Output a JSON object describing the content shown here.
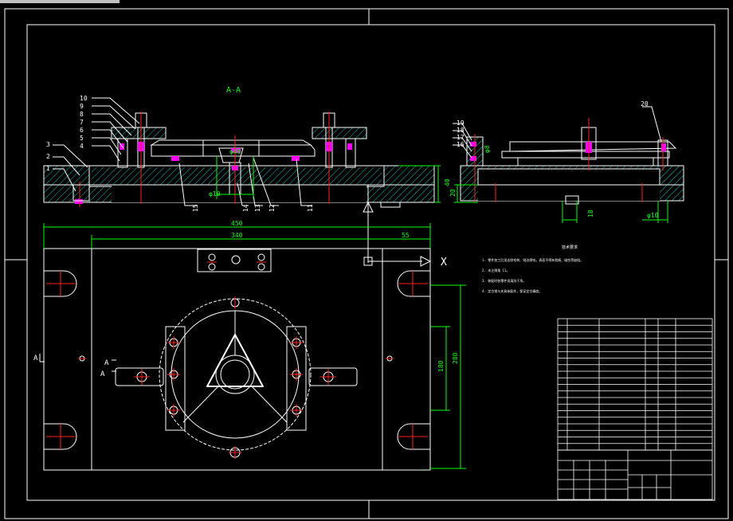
{
  "colors": {
    "background": "#000000",
    "line": "#ffffff",
    "dimension": "#00ff00",
    "centerline": "#ff2020",
    "hatch": "#00c0c0",
    "highlight": "#ff00ff",
    "label": "#ffffff"
  },
  "section_view": {
    "title": "A-A",
    "callouts": [
      "10",
      "9",
      "8",
      "7",
      "6",
      "5",
      "4",
      "3",
      "2",
      "1",
      "15",
      "14",
      "13",
      "12",
      "11"
    ],
    "dims": {
      "height": "40",
      "base": "20",
      "fit1": "φ40",
      "fit2": "φ10"
    }
  },
  "side_view": {
    "callouts": [
      "19",
      "18",
      "17",
      "16",
      "20"
    ],
    "dims": {
      "height": "20",
      "gap": "18",
      "fit": "φ8",
      "pin": "φ10"
    }
  },
  "plan_view": {
    "dims": {
      "overall_width": "450",
      "inner_width": "340",
      "offset": "55",
      "height1": "180",
      "height2": "280"
    },
    "section_marks": [
      "A",
      "A",
      "A"
    ],
    "axis_label": "X"
  },
  "notes": {
    "title": "技术要求",
    "lines": [
      "1. 零件加工后须去除毛刺、锐边倒钝，表面不得有划痕、碰伤等缺陷。",
      "2. 未注倒角 C1。",
      "3. 装配时各零件须清洗干净。",
      "4. 定位销与夹具体配作，保证定位精度。"
    ]
  },
  "title_block": {
    "heading": ""
  }
}
